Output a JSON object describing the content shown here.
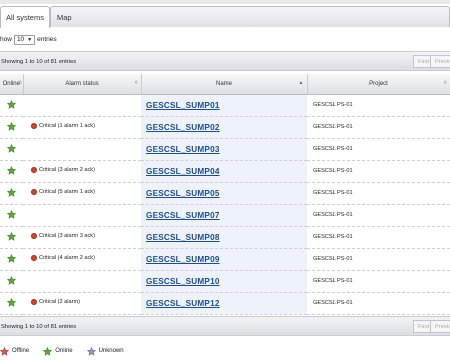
{
  "tabs": [
    {
      "label": "All systems"
    },
    {
      "label": "Map"
    }
  ],
  "show_entries": {
    "prefix": "how",
    "value": "10",
    "suffix": "entries"
  },
  "info_text": "Showing 1 to 10 of 81 entries",
  "pagination": {
    "first": "First",
    "previous": "Previo"
  },
  "table": {
    "headers": {
      "online": "Online",
      "alarm_status": "Alarm status",
      "name": "Name",
      "project": "Project"
    },
    "rows": [
      {
        "status": "online",
        "alarm": "",
        "name": "GESCSL_SUMP01",
        "project": "GESCSL PS-01"
      },
      {
        "status": "online",
        "alarm": "Critical (1 alarm 1 ack)",
        "name": "GESCSL_SUMP02",
        "project": "GESCSL PS-01"
      },
      {
        "status": "online",
        "alarm": "",
        "name": "GESCSL_SUMP03",
        "project": "GESCSL PS-01"
      },
      {
        "status": "online",
        "alarm": "Critical (3 alarm 2 ack)",
        "name": "GESCSL_SUMP04",
        "project": "GESCSL PS-01"
      },
      {
        "status": "online",
        "alarm": "Critical (5 alarm 1 ack)",
        "name": "GESCSL_SUMP05",
        "project": "GESCSL PS-01"
      },
      {
        "status": "online",
        "alarm": "",
        "name": "GESCSL_SUMP07",
        "project": "GESCSL PS-01"
      },
      {
        "status": "online",
        "alarm": "Critical (3 alarm 3 ack)",
        "name": "GESCSL_SUMP08",
        "project": "GESCSL PS-01"
      },
      {
        "status": "online",
        "alarm": "Critical (4 alarm 2 ack)",
        "name": "GESCSL_SUMP09",
        "project": "GESCSL PS-01"
      },
      {
        "status": "online",
        "alarm": "",
        "name": "GESCSL_SUMP10",
        "project": "GESCSL PS-01"
      },
      {
        "status": "online",
        "alarm": "Critical (2 alarm)",
        "name": "GESCSL_SUMP12",
        "project": "GESCSL PS-01"
      }
    ]
  },
  "legend": [
    {
      "label": "Offline",
      "color": "#d9534f"
    },
    {
      "label": "Online",
      "color": "#5aa832"
    },
    {
      "label": "Unknown",
      "color": "#9b8fc2"
    }
  ],
  "colors": {
    "online": "#5aa832",
    "critical": "#d64528",
    "link": "#1f4e8c"
  }
}
